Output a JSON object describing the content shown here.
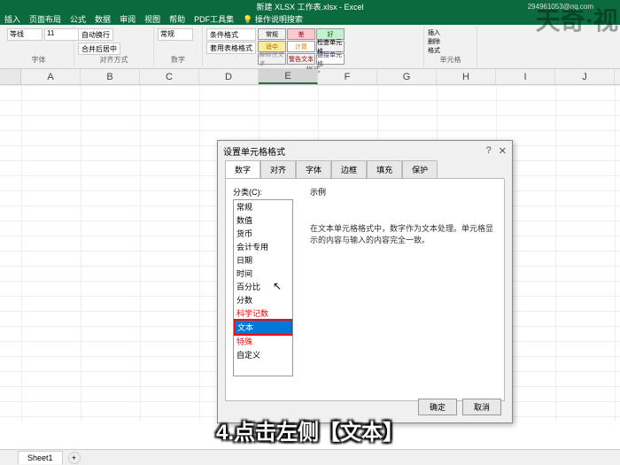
{
  "title": "新建 XLSX 工作表.xlsx - Excel",
  "user": "294961053@qq.com",
  "menu": [
    "插入",
    "页面布局",
    "公式",
    "数据",
    "审阅",
    "视图",
    "帮助",
    "PDF工具集"
  ],
  "tell_me": "操作说明搜索",
  "ribbon": {
    "font_group": "字体",
    "align_group": "对齐方式",
    "number_group": "数字",
    "styles_group": "样式",
    "cells_group": "单元格",
    "wrap": "自动换行",
    "merge": "合并后居中",
    "format_general": "常规",
    "cond_format": "条件格式",
    "table_format": "套用表格格式",
    "cs": {
      "bad": "差",
      "good": "好",
      "neutral": "适中",
      "normal": "常规",
      "calc": "计算",
      "check": "检查单元格",
      "explain": "解释性文本",
      "warn": "警告文本",
      "linked": "链接单元格"
    },
    "insert": "插入",
    "delete": "删除",
    "format": "格式"
  },
  "cols": [
    "A",
    "B",
    "C",
    "D",
    "E",
    "F",
    "G",
    "H",
    "I",
    "J"
  ],
  "dialog": {
    "title": "设置单元格格式",
    "tabs": [
      "数字",
      "对齐",
      "字体",
      "边框",
      "填充",
      "保护"
    ],
    "category_label": "分类(C):",
    "categories": [
      "常规",
      "数值",
      "货币",
      "会计专用",
      "日期",
      "时间",
      "百分比",
      "分数",
      "科学记数",
      "文本",
      "特殊",
      "自定义"
    ],
    "sample_label": "示例",
    "desc": "在文本单元格格式中，数字作为文本处理。单元格显示的内容与输入的内容完全一致。",
    "ok": "确定",
    "cancel": "取消"
  },
  "sheet": "Sheet1",
  "caption": "4.点击左侧【文本】",
  "watermark": "天奇·视",
  "help": "?",
  "close": "✕"
}
